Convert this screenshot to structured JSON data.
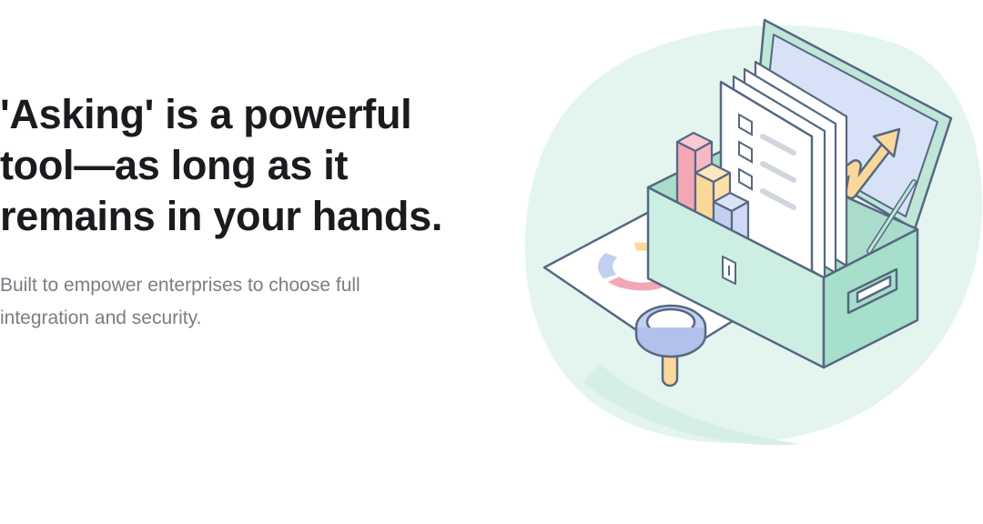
{
  "hero": {
    "title": "'Asking' is a powerful tool—as long as it remains in your hands.",
    "subtitle": "Built to empower enterprises to choose full integration and security."
  },
  "illustration": {
    "icon": "toolbox-with-documents-and-charts-illustration",
    "colors": {
      "blob": "#e4f5ef",
      "box": "#cdeee2",
      "outline": "#566882",
      "pink": "#f3a7b4",
      "yellow": "#fcd79a",
      "blue": "#c3cff0"
    }
  }
}
